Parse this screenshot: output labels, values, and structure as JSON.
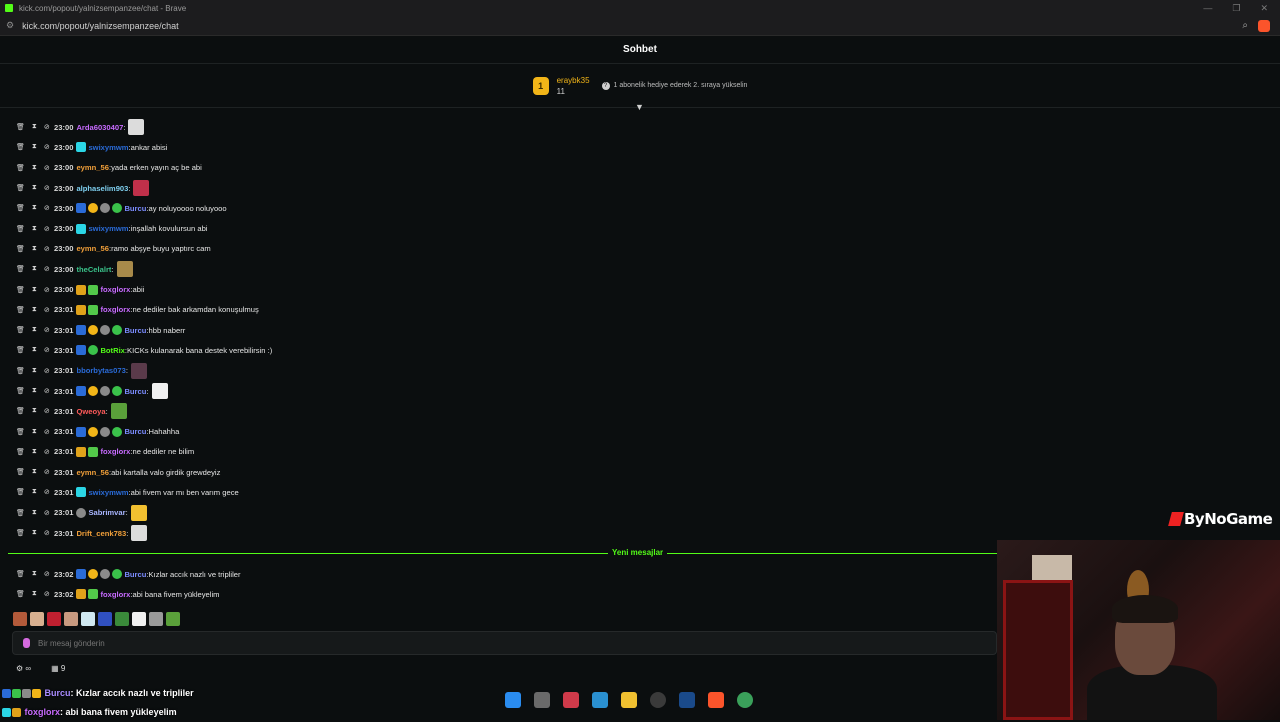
{
  "browser": {
    "window_title": "kick.com/popout/yalnizsempanzee/chat - Brave",
    "url": "kick.com/popout/yalnizsempanzee/chat"
  },
  "chat": {
    "title": "Sohbet",
    "pinned": {
      "rank": "1",
      "username": "eraybk35",
      "count": "11",
      "info": "1 abonelik hediye ederek 2. sıraya yükselin"
    },
    "messages": [
      {
        "time": "23:00",
        "user": "Arda6030407",
        "sep": ":",
        "text": "",
        "color": "#c86bff",
        "badges": [],
        "emote": "#dcdcdc"
      },
      {
        "time": "23:00",
        "user": "swixymwm",
        "sep": ":",
        "text": " ankar abisi",
        "color": "#2a6bd8",
        "badges": [
          "b-cyan"
        ],
        "emote": ""
      },
      {
        "time": "23:00",
        "user": "eymn_56",
        "sep": ":",
        "text": " yada erken yayın aç be abi",
        "color": "#f2a03a",
        "badges": [],
        "emote": ""
      },
      {
        "time": "23:00",
        "user": "alphaselim903",
        "sep": ":",
        "text": "",
        "color": "#7fd0f0",
        "badges": [],
        "emote": "#c0304a"
      },
      {
        "time": "23:00",
        "user": "Burcu",
        "sep": ":",
        "text": " ay noluyoooo noluyooo",
        "color": "#7b8cff",
        "badges": [
          "b-blue",
          "b-gold",
          "b-gray",
          "b-green"
        ],
        "emote": ""
      },
      {
        "time": "23:00",
        "user": "swixymwm",
        "sep": ":",
        "text": " inşallah kovulursun abi",
        "color": "#2a6bd8",
        "badges": [
          "b-cyan"
        ],
        "emote": ""
      },
      {
        "time": "23:00",
        "user": "eymn_56",
        "sep": ":",
        "text": " ramo abşye buyu yaptırc cam",
        "color": "#f2a03a",
        "badges": [],
        "emote": ""
      },
      {
        "time": "23:00",
        "user": "theCelalrt",
        "sep": ":",
        "text": "",
        "color": "#3ac28a",
        "badges": [],
        "emote": "#a88a4a"
      },
      {
        "time": "23:00",
        "user": "foxglorx",
        "sep": ":",
        "text": " abii",
        "color": "#c86bff",
        "badges": [
          "b-crown",
          "b-sub"
        ],
        "emote": ""
      },
      {
        "time": "23:01",
        "user": "foxglorx",
        "sep": ":",
        "text": " ne dediler bak arkamdan konuşulmuş",
        "color": "#c86bff",
        "badges": [
          "b-crown",
          "b-sub"
        ],
        "emote": ""
      },
      {
        "time": "23:01",
        "user": "Burcu",
        "sep": ":",
        "text": " hbb naberr",
        "color": "#7b8cff",
        "badges": [
          "b-blue",
          "b-gold",
          "b-gray",
          "b-green"
        ],
        "emote": ""
      },
      {
        "time": "23:01",
        "user": "BotRix",
        "sep": ":",
        "text": " KICKs kulanarak bana destek verebilirsin :)",
        "color": "#53fc18",
        "badges": [
          "b-blue",
          "b-green"
        ],
        "emote": ""
      },
      {
        "time": "23:01",
        "user": "bborbytas073",
        "sep": ":",
        "text": "",
        "color": "#2a6bd8",
        "badges": [],
        "emote": "#5a3a4a"
      },
      {
        "time": "23:01",
        "user": "Burcu",
        "sep": ":",
        "text": "",
        "color": "#7b8cff",
        "badges": [
          "b-blue",
          "b-gold",
          "b-gray",
          "b-green"
        ],
        "emote": "#f0f0f0"
      },
      {
        "time": "23:01",
        "user": "Qweoya",
        "sep": ":",
        "text": "",
        "color": "#ff5a5a",
        "badges": [],
        "emote": "#5aa03a"
      },
      {
        "time": "23:01",
        "user": "Burcu",
        "sep": ":",
        "text": " Hahahha",
        "color": "#7b8cff",
        "badges": [
          "b-blue",
          "b-gold",
          "b-gray",
          "b-green"
        ],
        "emote": ""
      },
      {
        "time": "23:01",
        "user": "foxglorx",
        "sep": ":",
        "text": " ne dediler ne bilim",
        "color": "#c86bff",
        "badges": [
          "b-crown",
          "b-sub"
        ],
        "emote": ""
      },
      {
        "time": "23:01",
        "user": "eymn_56",
        "sep": ":",
        "text": " abi kartalla valo girdik grewdeyiz",
        "color": "#f2a03a",
        "badges": [],
        "emote": ""
      },
      {
        "time": "23:01",
        "user": "swixymwm",
        "sep": ":",
        "text": " abi fivem var mı ben varım gece",
        "color": "#2a6bd8",
        "badges": [
          "b-cyan"
        ],
        "emote": ""
      },
      {
        "time": "23:01",
        "user": "Sabrimvar",
        "sep": ":",
        "text": "",
        "color": "#a9b6ff",
        "badges": [
          "b-gray"
        ],
        "emote": "#f2c030"
      },
      {
        "time": "23:01",
        "user": "Drift_cenk783",
        "sep": ":",
        "text": "",
        "color": "#f2a03a",
        "badges": [],
        "emote": "#dcdcdc"
      }
    ],
    "new_messages_label": "Yeni mesajlar",
    "new_messages": [
      {
        "time": "23:02",
        "user": "Burcu",
        "sep": ":",
        "text": " Kızlar accık nazlı ve tripliler",
        "color": "#7b8cff",
        "badges": [
          "b-blue",
          "b-gold",
          "b-gray",
          "b-green"
        ],
        "emote": ""
      },
      {
        "time": "23:02",
        "user": "foxglorx",
        "sep": ":",
        "text": " abi bana fivem yükleyelim",
        "color": "#c86bff",
        "badges": [
          "b-crown",
          "b-sub"
        ],
        "emote": ""
      }
    ],
    "input_placeholder": "Bir mesaj gönderin",
    "below_input": {
      "icon_label": "∞",
      "count": "9"
    }
  },
  "overlay": {
    "line1_user": "Burcu",
    "line1_text": ": Kızlar accık nazlı ve tripliler",
    "line2_user": "foxglorx",
    "line2_text": ": abi bana fivem yükleyelim",
    "sponsor": "ByNoGame"
  },
  "colors": {
    "accent": "#53fc18",
    "background": "#0b0e0f"
  }
}
